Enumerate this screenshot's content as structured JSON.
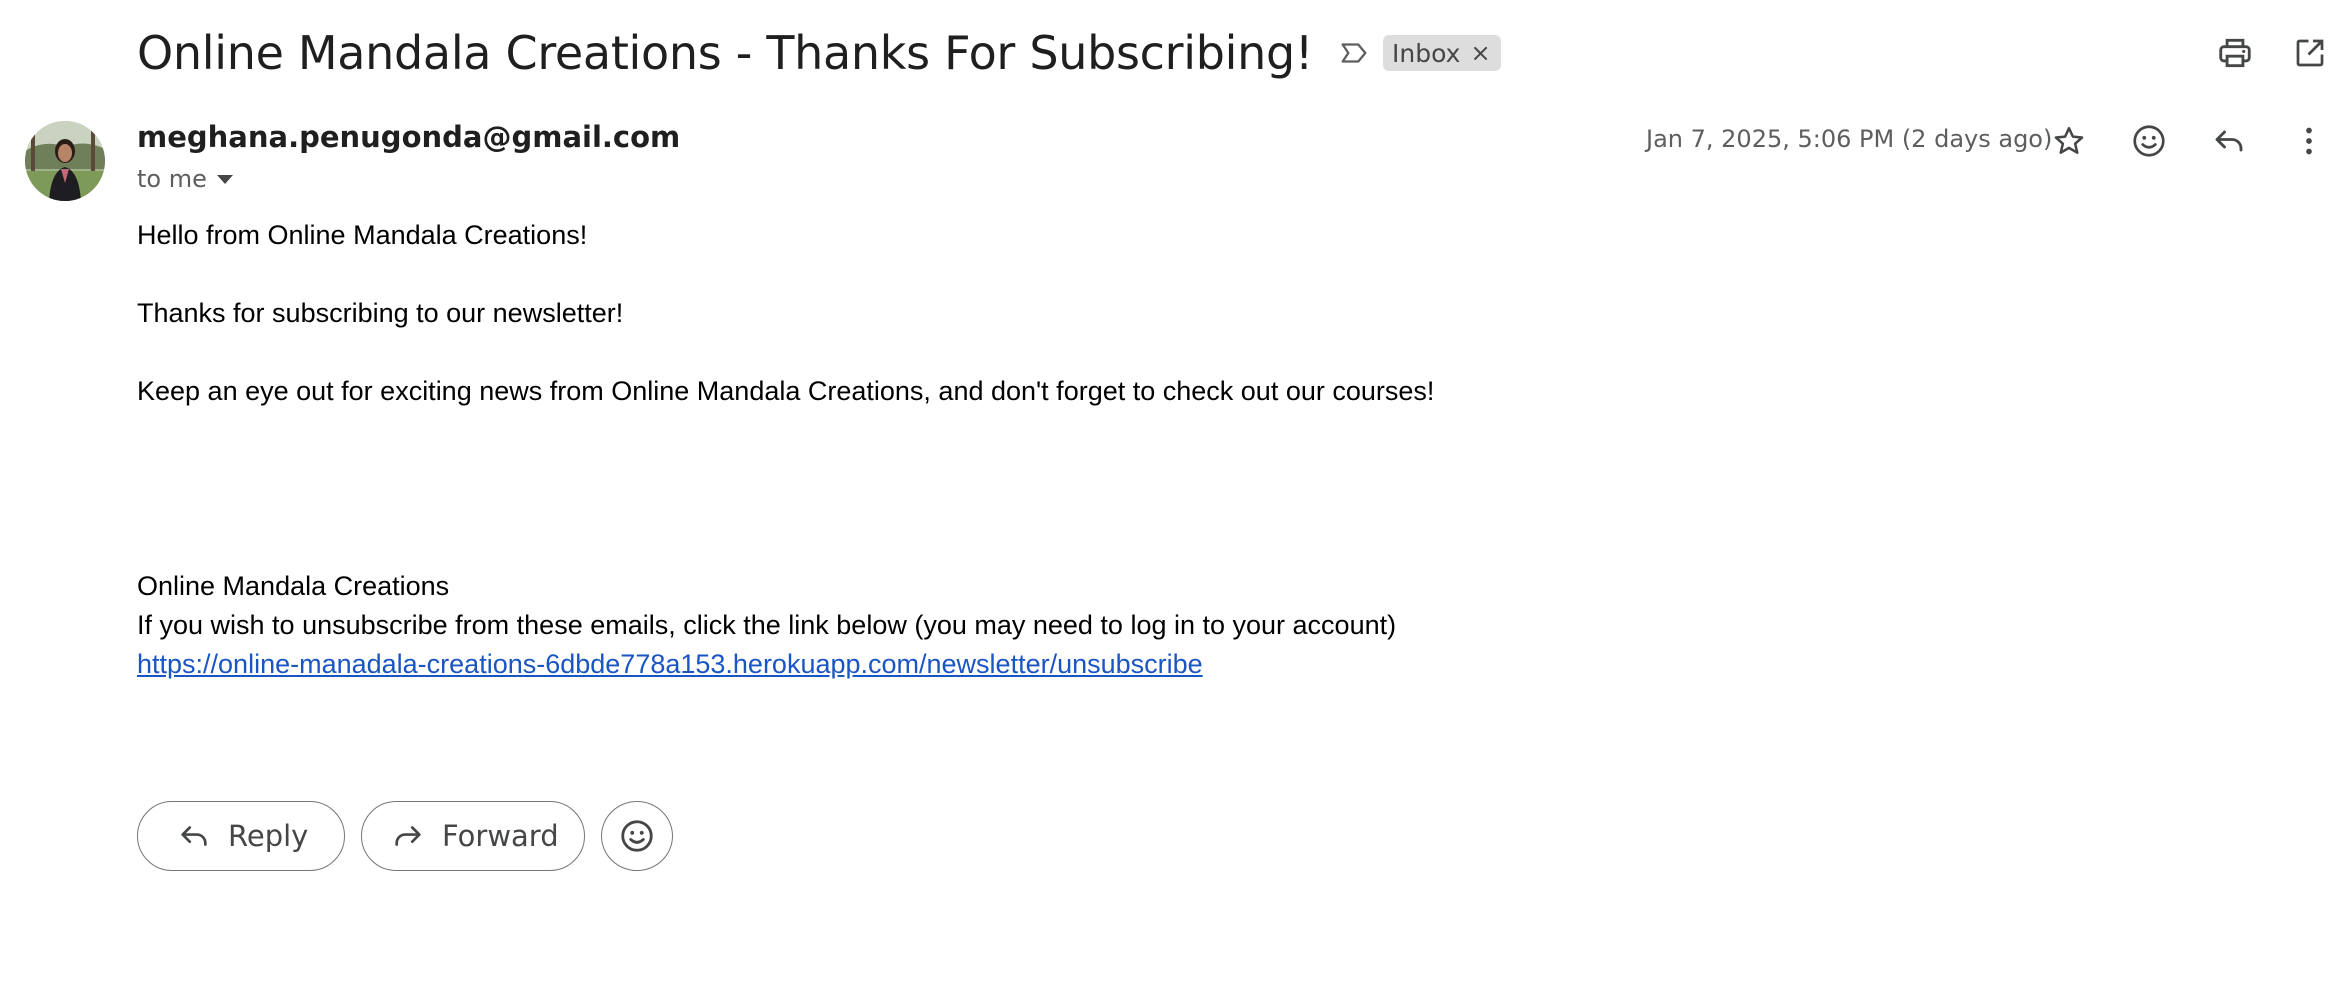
{
  "email": {
    "subject": "Online Mandala Creations - Thanks For Subscribing!",
    "label_chip": "Inbox",
    "label_chip_close": "×",
    "sender": "meghana.penugonda@gmail.com",
    "recipient_summary": "to me",
    "date": "Jan 7, 2025, 5:06 PM (2 days ago)",
    "body": {
      "line1": "Hello from Online Mandala Creations!",
      "line2": "Thanks for subscribing to our newsletter!",
      "line3": "Keep an eye out for exciting news from Online Mandala Creations, and don't forget to check out our courses!",
      "signature_name": "Online Mandala Creations",
      "unsubscribe_text": "If you wish to unsubscribe from these emails, click the link below (you may need to log in to your account)",
      "unsubscribe_link": "https://online-manadala-creations-6dbde778a153.herokuapp.com/newsletter/unsubscribe"
    }
  },
  "actions": {
    "reply_label": "Reply",
    "forward_label": "Forward"
  },
  "icons": {
    "label": "label-outline-icon",
    "print": "print-icon",
    "popout": "open-in-new-window-icon",
    "star": "star-outline-icon",
    "emoji": "emoji-smile-icon",
    "reply": "reply-icon",
    "more": "more-vertical-icon",
    "forward": "forward-icon"
  },
  "colors": {
    "link": "#1a55c4",
    "chip_bg": "#dddddd",
    "icon": "#444746"
  }
}
